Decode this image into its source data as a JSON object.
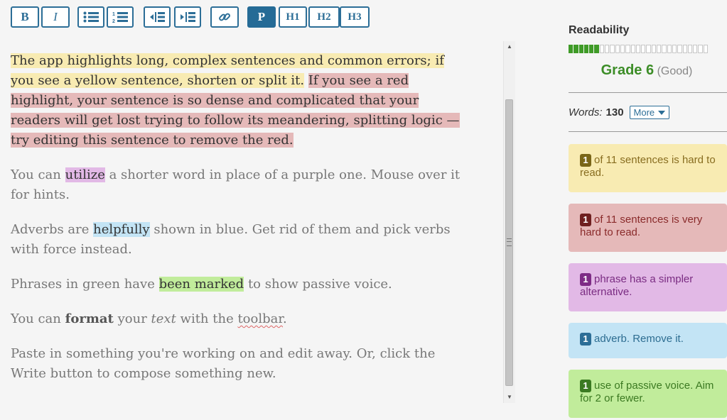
{
  "toolbar": {
    "bold": "B",
    "italic": "I",
    "paragraph": "P",
    "h1": "H1",
    "h2": "H2",
    "h3": "H3",
    "icons": [
      "bulleted-list-icon",
      "numbered-list-icon",
      "outdent-icon",
      "indent-icon",
      "link-icon"
    ]
  },
  "editor": {
    "p1_yellow": "The app highlights long, complex sentences and common errors; if you see a yellow sentence, shorten or split it.",
    "p1_red": "If you see a red highlight, your sentence is so dense and complicated that your readers will get lost trying to follow its meandering, splitting logic — try editing this sentence to remove the red.",
    "p2_a": "You can ",
    "p2_word": "utilize",
    "p2_b": " a shorter word in place of a purple one. Mouse over it for hints.",
    "p3_a": "Adverbs are ",
    "p3_word": "helpfully",
    "p3_b": " shown in blue. Get rid of them and pick verbs with force instead.",
    "p4_a": "Phrases in green have ",
    "p4_phrase": "been marked",
    "p4_b": " to show passive voice.",
    "p5_a": "You can ",
    "p5_bold": "format",
    "p5_b": " your ",
    "p5_italic": "text",
    "p5_c": " with the ",
    "p5_word": "toolbar",
    "p5_d": ".",
    "p6": "Paste in something you're working on and edit away. Or, click the Write button to compose something new."
  },
  "sidebar": {
    "readability_title": "Readability",
    "meter_on": 6,
    "meter_total": 27,
    "grade": "Grade 6",
    "grade_note": "(Good)",
    "words_label": "Words:",
    "words_count": "130",
    "more_label": "More",
    "cards": {
      "hard": {
        "count": "1",
        "text": "of 11 sentences is hard to read."
      },
      "very_hard": {
        "count": "1",
        "text": "of 11 sentences is very hard to read."
      },
      "simpler": {
        "count": "1",
        "text": "phrase has a simpler alternative."
      },
      "adverb": {
        "count": "1",
        "text": "adverb. Remove it."
      },
      "passive": {
        "count": "1",
        "text": "use of passive voice. Aim for 2 or fewer."
      }
    }
  },
  "colors": {
    "accent": "#2c6e97",
    "grade_green": "#3c8d27",
    "yellow": "#f8ebb2",
    "red": "#e5b9b9",
    "purple": "#e2b9e6",
    "blue": "#c3e4f5",
    "green": "#c1ec9b"
  }
}
